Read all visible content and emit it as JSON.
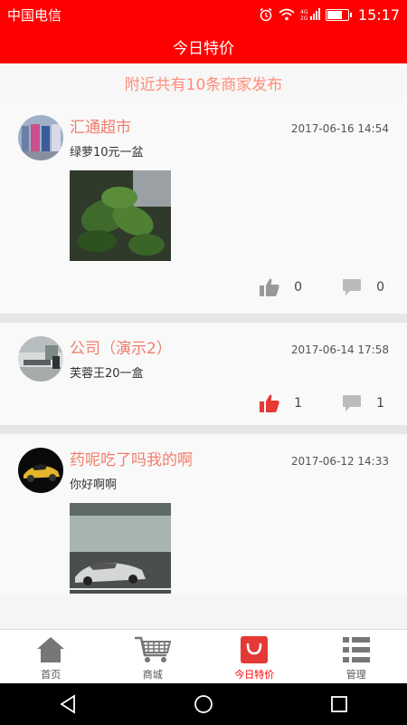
{
  "status_bar": {
    "carrier": "中国电信",
    "time": "15:17",
    "battery_level": 0.75
  },
  "header": {
    "title": "今日特价"
  },
  "nearby_text": "附近共有10条商家发布",
  "posts": [
    {
      "shop": "汇通超市",
      "time": "2017-06-16 14:54",
      "desc": "绿萝10元一盆",
      "likes": "0",
      "comments": "0",
      "liked": false,
      "has_photo": true
    },
    {
      "shop": "公司（演示2）",
      "time": "2017-06-14 17:58",
      "desc": "芙蓉王20一盒",
      "likes": "1",
      "comments": "1",
      "liked": true,
      "has_photo": false
    },
    {
      "shop": "药呢吃了吗我的啊",
      "time": "2017-06-12 14:33",
      "desc": "你好啊啊",
      "likes": "",
      "comments": "",
      "liked": false,
      "has_photo": true
    }
  ],
  "tabs": [
    {
      "label": "首页",
      "icon": "home-icon",
      "active": false
    },
    {
      "label": "商城",
      "icon": "cart-icon",
      "active": false
    },
    {
      "label": "今日特价",
      "icon": "shopping-bag-icon",
      "active": true
    },
    {
      "label": "管理",
      "icon": "list-icon",
      "active": false
    }
  ],
  "colors": {
    "primary": "#ff0000",
    "shop_name": "#f07d6b",
    "nearby": "#ff8c78",
    "liked": "#e53935",
    "icon_gray": "#999999"
  }
}
